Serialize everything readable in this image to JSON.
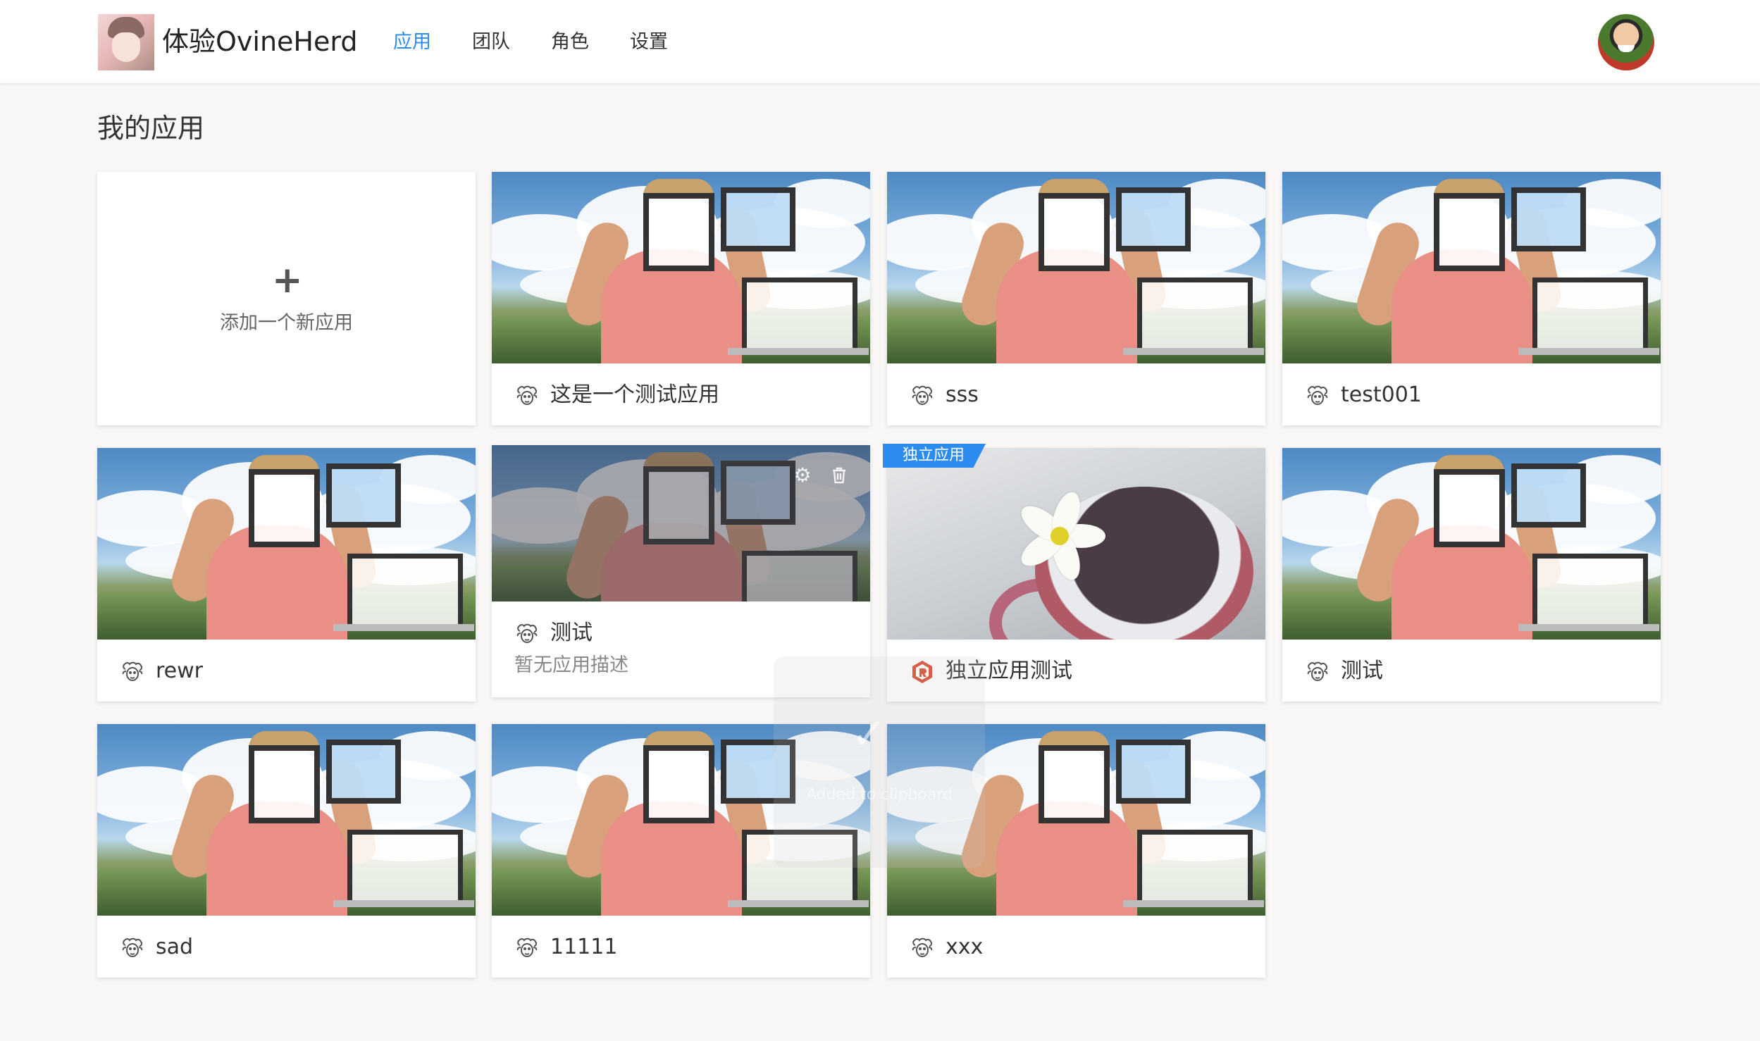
{
  "header": {
    "brand": "体验OvineHerd",
    "nav": [
      "应用",
      "团队",
      "角色",
      "设置"
    ],
    "active_nav": "应用"
  },
  "page_title": "我的应用",
  "add_card": {
    "plus": "+",
    "label": "添加一个新应用"
  },
  "apps": [
    {
      "name": "这是一个测试应用"
    },
    {
      "name": "sss"
    },
    {
      "name": "test001"
    },
    {
      "name": "rewr"
    },
    {
      "name": "测试",
      "description": "暂无应用描述",
      "hovered": true,
      "actions": [
        "gear-icon",
        "trash-icon"
      ]
    },
    {
      "name": "独立应用测试",
      "badge": "独立应用"
    },
    {
      "name": "测试"
    },
    {
      "name": "sad"
    },
    {
      "name": "11111"
    },
    {
      "name": "xxx"
    }
  ],
  "toast": {
    "text": "Added to clipboard"
  },
  "colors": {
    "accent": "#2d8cf0",
    "background": "#f8f7f6"
  }
}
